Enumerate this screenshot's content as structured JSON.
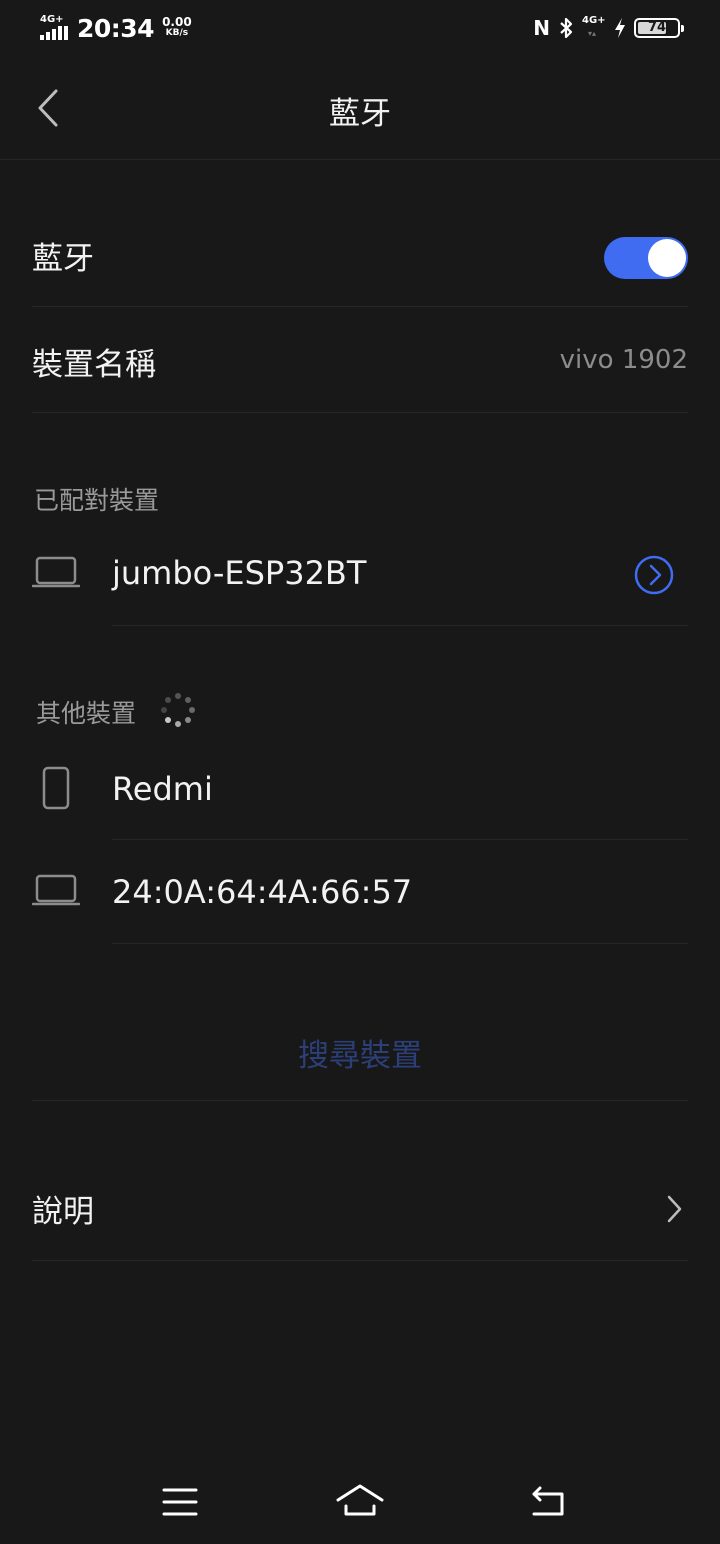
{
  "status_bar": {
    "network_left": "4G+",
    "time": "20:34",
    "speed_value": "0.00",
    "speed_unit": "KB/s",
    "nfc_label": "N",
    "network_right": "4G+",
    "battery_percent": "74",
    "battery_level": 0.74
  },
  "header": {
    "title": "藍牙"
  },
  "bluetooth_row": {
    "label": "藍牙",
    "enabled": true
  },
  "device_name_row": {
    "label": "裝置名稱",
    "value": "vivo 1902"
  },
  "paired_section": {
    "title": "已配對裝置",
    "devices": [
      {
        "name": "jumbo-ESP32BT",
        "icon": "laptop-icon"
      }
    ]
  },
  "other_section": {
    "title": "其他裝置",
    "devices": [
      {
        "name": "Redmi",
        "icon": "phone-icon"
      },
      {
        "name": "24:0A:64:4A:66:57",
        "icon": "laptop-icon"
      }
    ]
  },
  "search_button": {
    "label": "搜尋裝置"
  },
  "help_row": {
    "label": "說明"
  },
  "colors": {
    "background": "#181818",
    "accent": "#3f6cf1",
    "search_text": "#2c3f78",
    "secondary_text": "#8c8c8c"
  }
}
